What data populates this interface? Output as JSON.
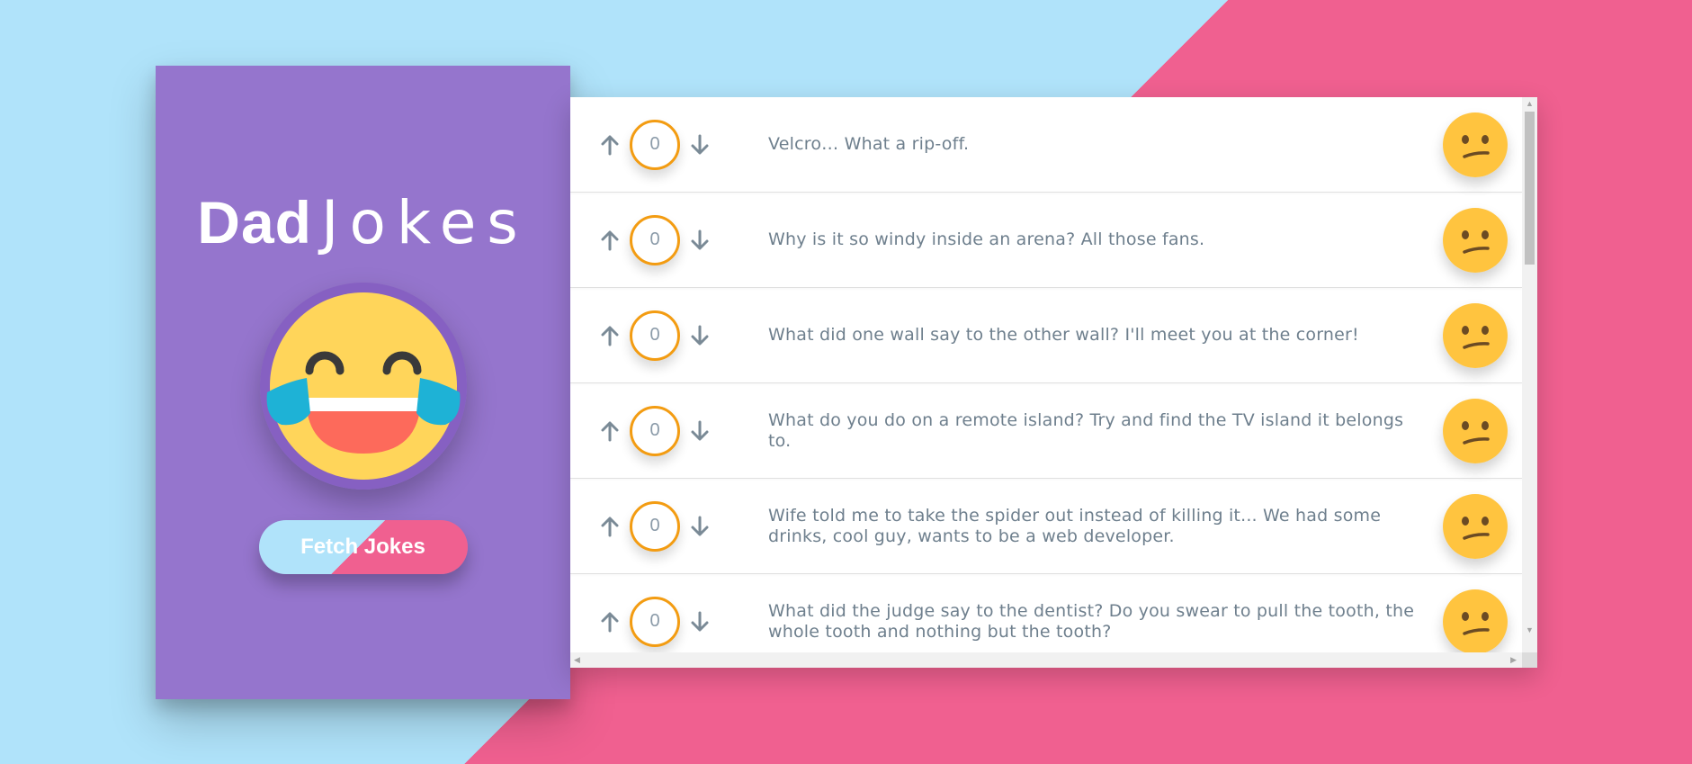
{
  "app": {
    "title_bold": "Dad",
    "title_thin": "Jokes",
    "fetch_label": "Fetch Jokes"
  },
  "colors": {
    "sidebar": "#9575cd",
    "bg_blue": "#b0e3fa",
    "bg_pink": "#f06090",
    "score_border": "#f39c12",
    "joke_text": "#6e7f8d"
  },
  "icons": {
    "upvote": "arrow-up-icon",
    "downvote": "arrow-down-icon",
    "logo": "laughing-tears-emoji-icon",
    "rating": "confused-face-emoji-icon"
  },
  "jokes": [
    {
      "score": "0",
      "text": "Velcro… What a rip-off."
    },
    {
      "score": "0",
      "text": "Why is it so windy inside an arena? All those fans."
    },
    {
      "score": "0",
      "text": "What did one wall say to the other wall? I'll meet you at the corner!"
    },
    {
      "score": "0",
      "text": "What do you do on a remote island? Try and find the TV island it belongs to."
    },
    {
      "score": "0",
      "text": "Wife told me to take the spider out instead of killing it... We had some drinks, cool guy, wants to be a web developer."
    },
    {
      "score": "0",
      "text": "What did the judge say to the dentist? Do you swear to pull the tooth, the whole tooth and nothing but the tooth?"
    }
  ]
}
